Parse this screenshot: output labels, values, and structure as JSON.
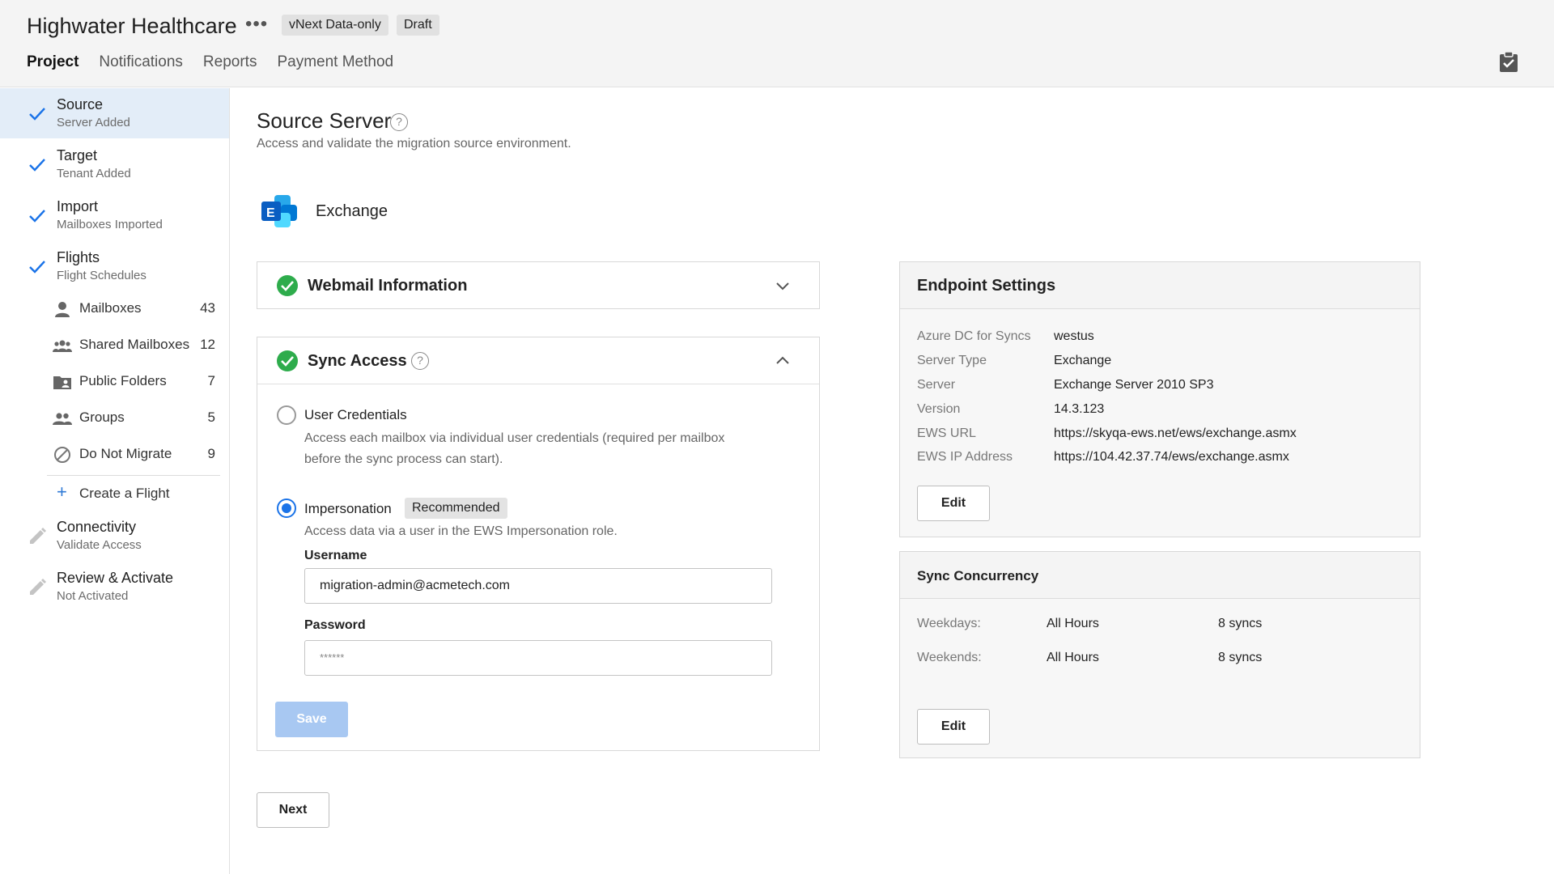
{
  "header": {
    "title": "Highwater Healthcare",
    "more_icon": "more-horizontal-icon",
    "chips": [
      "vNext Data-only",
      "Draft"
    ],
    "tabs": [
      "Project",
      "Notifications",
      "Reports",
      "Payment Method"
    ],
    "active_tab": "Project",
    "right_icon": "clipboard-check-icon"
  },
  "sidebar": {
    "steps": [
      {
        "title": "Source",
        "sub": "Server Added",
        "status": "done",
        "active": true
      },
      {
        "title": "Target",
        "sub": "Tenant Added",
        "status": "done"
      },
      {
        "title": "Import",
        "sub": "Mailboxes Imported",
        "status": "done"
      },
      {
        "title": "Flights",
        "sub": "Flight Schedules",
        "status": "done"
      },
      {
        "title": "Connectivity",
        "sub": "Validate Access",
        "status": "pending"
      },
      {
        "title": "Review & Activate",
        "sub": "Not Activated",
        "status": "pending"
      }
    ],
    "sub_items": [
      {
        "label": "Mailboxes",
        "count": "43",
        "icon": "person-icon"
      },
      {
        "label": "Shared Mailboxes",
        "count": "12",
        "icon": "people-group-icon"
      },
      {
        "label": "Public Folders",
        "count": "7",
        "icon": "folder-person-icon"
      },
      {
        "label": "Groups",
        "count": "5",
        "icon": "people-icon"
      },
      {
        "label": "Do Not Migrate",
        "count": "9",
        "icon": "block-icon"
      }
    ],
    "create_flight": "Create a Flight"
  },
  "main": {
    "title": "Source Server",
    "subtitle": "Access and validate the migration source environment.",
    "source_type": "Exchange",
    "webmail": {
      "title": "Webmail Information"
    },
    "sync_access": {
      "title": "Sync Access",
      "options": [
        {
          "label": "User Credentials",
          "desc_line1": "Access each mailbox via individual user credentials (required per mailbox",
          "desc_line2": "before the sync process can start).",
          "selected": false
        },
        {
          "label": "Impersonation",
          "badge": "Recommended",
          "desc_line1": "Access data via a user in the EWS Impersonation role.",
          "selected": true
        }
      ],
      "username_label": "Username",
      "username_value": "migration-admin@acmetech.com",
      "password_label": "Password",
      "password_value": "******",
      "save_label": "Save"
    },
    "next_label": "Next"
  },
  "endpoint": {
    "title": "Endpoint Settings",
    "rows": [
      {
        "key": "Azure DC for Syncs",
        "value": "westus"
      },
      {
        "key": "Server Type",
        "value": "Exchange"
      },
      {
        "key": "Server",
        "value": "Exchange Server 2010 SP3"
      },
      {
        "key": "Version",
        "value": "14.3.123"
      },
      {
        "key": "EWS URL",
        "value": "https://skyqa-ews.net/ews/exchange.asmx"
      },
      {
        "key": "EWS IP Address",
        "value": "https://104.42.37.74/ews/exchange.asmx"
      }
    ],
    "edit_label": "Edit"
  },
  "concurrency": {
    "title": "Sync Concurrency",
    "rows": [
      {
        "key": "Weekdays:",
        "hours": "All Hours",
        "syncs": "8 syncs"
      },
      {
        "key": "Weekends:",
        "hours": "All Hours",
        "syncs": "8 syncs"
      }
    ],
    "edit_label": "Edit"
  },
  "colors": {
    "accent": "#1a73e8",
    "success": "#2eac4c",
    "active_step_bg": "#e3edf8",
    "save_disabled": "#a8c8f2"
  }
}
